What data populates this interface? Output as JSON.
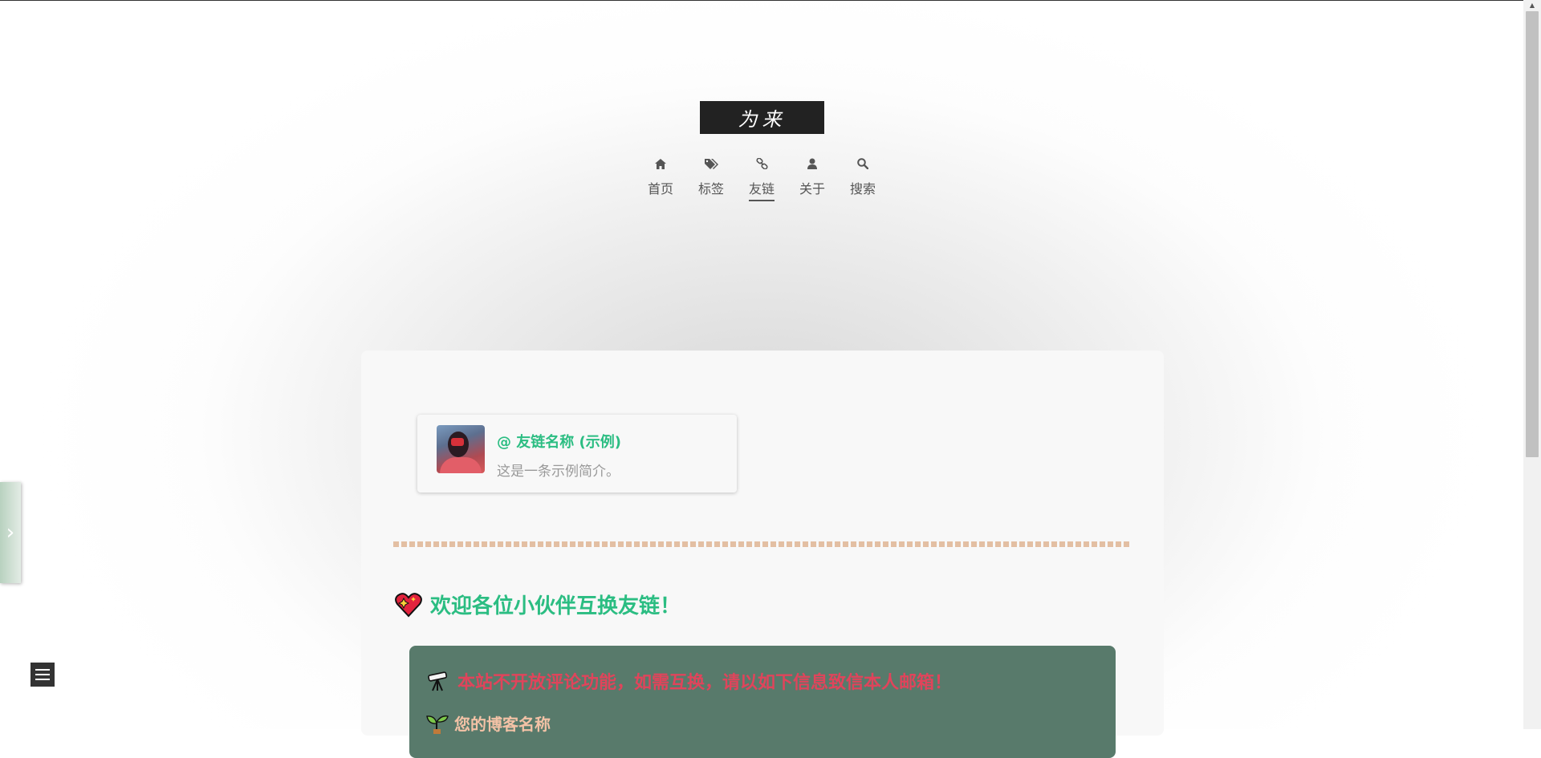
{
  "site": {
    "logo_text": "为来"
  },
  "nav": {
    "items": [
      {
        "label": "首页",
        "icon": "home-icon",
        "glyph": "⌂"
      },
      {
        "label": "标签",
        "icon": "tags-icon",
        "glyph": "◆"
      },
      {
        "label": "友链",
        "icon": "link-icon",
        "glyph": "∞",
        "active": true
      },
      {
        "label": "关于",
        "icon": "user-icon",
        "glyph": "●"
      },
      {
        "label": "搜索",
        "icon": "search-icon",
        "glyph": "⌕"
      }
    ]
  },
  "friend_card": {
    "name": "@ 友链名称 (示例)",
    "description": "这是一条示例简介。"
  },
  "welcome": {
    "text": "欢迎各位小伙伴互换友链！"
  },
  "notice": {
    "line1": "本站不开放评论功能，如需互换，请以如下信息致信本人邮箱！",
    "line2": "您的博客名称"
  },
  "side_tab": {
    "glyph": "›"
  },
  "colors": {
    "accent_green": "#2bbd82",
    "notice_bg": "#587a6b",
    "notice_red": "#e0445b",
    "divider": "#e3bfa3"
  }
}
